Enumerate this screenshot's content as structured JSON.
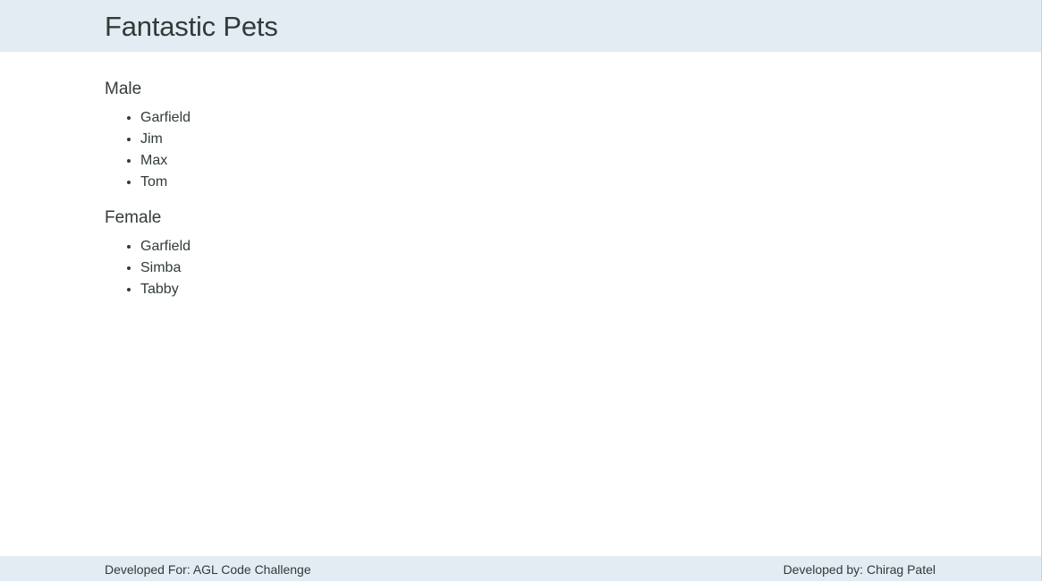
{
  "header": {
    "title": "Fantastic Pets"
  },
  "groups": [
    {
      "heading": "Male",
      "items": [
        "Garfield",
        "Jim",
        "Max",
        "Tom"
      ]
    },
    {
      "heading": "Female",
      "items": [
        "Garfield",
        "Simba",
        "Tabby"
      ]
    }
  ],
  "footer": {
    "left": "Developed For: AGL Code Challenge",
    "right": "Developed by: Chirag Patel"
  }
}
